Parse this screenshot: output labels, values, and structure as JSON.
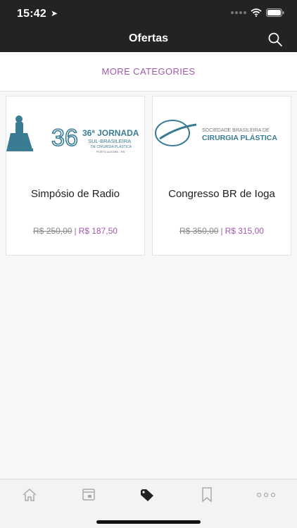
{
  "status_bar": {
    "time": "15:42",
    "location_icon": "location-arrow-icon",
    "signal_icon": "cellular-dots-icon",
    "wifi_icon": "wifi-icon",
    "battery_icon": "battery-icon"
  },
  "nav": {
    "title": "Ofertas",
    "search_icon": "search-icon"
  },
  "categories": {
    "label": "MORE CATEGORIES"
  },
  "products": [
    {
      "image_text": [
        "36ª JORNADA",
        "SUL-BRASILEIRA",
        "DE CIRURGIA PLÁSTICA",
        "PORTO ALEGRE - RS"
      ],
      "name": "Simpósio de Radio",
      "old_price": "R$  250,00",
      "new_price": "R$  187,50"
    },
    {
      "image_text": [
        "SOCIEDADE BRASILEIRA DE",
        "CIRURGIA PLÁSTICA"
      ],
      "name": "Congresso BR de Ioga",
      "old_price": "R$  350,00",
      "new_price": "R$  315,00"
    }
  ],
  "price_separator": "|",
  "tab_bar": {
    "items": [
      {
        "icon": "home-icon"
      },
      {
        "icon": "calendar-icon"
      },
      {
        "icon": "tag-icon",
        "active": true
      },
      {
        "icon": "bookmark-icon"
      },
      {
        "icon": "more-dots-icon"
      }
    ]
  },
  "colors": {
    "accent": "#a259ad",
    "dark": "#232323",
    "logo_blue": "#3a7c93"
  }
}
